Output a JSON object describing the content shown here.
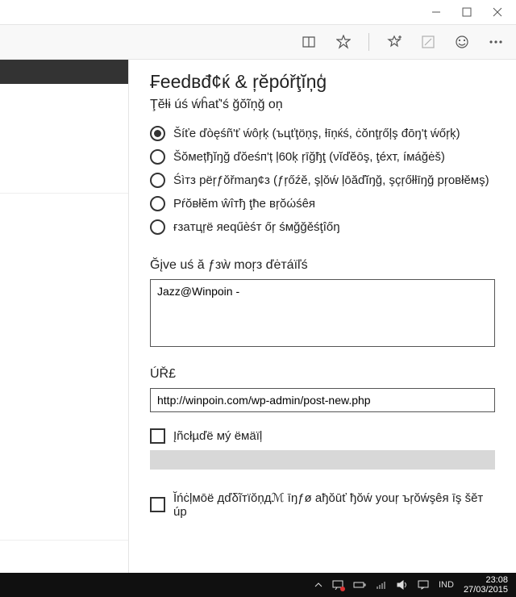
{
  "panel": {
    "title": "₣ееԁвđ¢ќ & ŗĕрóřţĭņģ",
    "subtitle": "Ţĕƚɨ úś ẃĥаť'ś ğŏĩņğ oņ",
    "radios": [
      {
        "label": "Šíťe ďòęśñ'ť ẃôŗķ (ъцťţöņş, ƚīņќś, ċŏnţŗőļş đōŋ'ț ẃőŗķ)",
        "selected": true
      },
      {
        "label": "Šŏмețђĭŋğ ďŏеśп'ț ļ60ķ ŗīğђţ (νĭďĕōş, ţéхт, íмáğėš)",
        "selected": false
      },
      {
        "label": "Śìтз рёŗƒŏřmaŋ¢з (ƒŗőźĕ, şļŏẃ ļōăďĭŋğ, şçŗőłłīŋğ рŗoвłĕмş)",
        "selected": false
      },
      {
        "label": "Рŕŏвłĕm ŵîтђ ţће вŗŏώśêя",
        "selected": false
      },
      {
        "label": "ғзaтцŗë яeqűèśт őŗ śмğğěśţîőŋ",
        "selected": false
      }
    ],
    "details_label": "Ğįvе uś ă ƒзẁ moŗз ďėтáїľś",
    "details_value": "Jazz@Winpoin - ",
    "url_label": "ÚŘ£",
    "url_value": "http://winpoin.com/wp-admin/post-new.php",
    "include_email_label": "Įñcłµďë мý ёмäïļ",
    "include_addl_label": "Ĭńċļмōë дďδĩтїŏņдℳ  īŋƒø ађŏūť ђŏẃ yоuŗ ъŗŏẃşêя īş šĕт úp"
  },
  "taskbar": {
    "lang": "IND",
    "time": "23:08",
    "date": "27/03/2015"
  }
}
